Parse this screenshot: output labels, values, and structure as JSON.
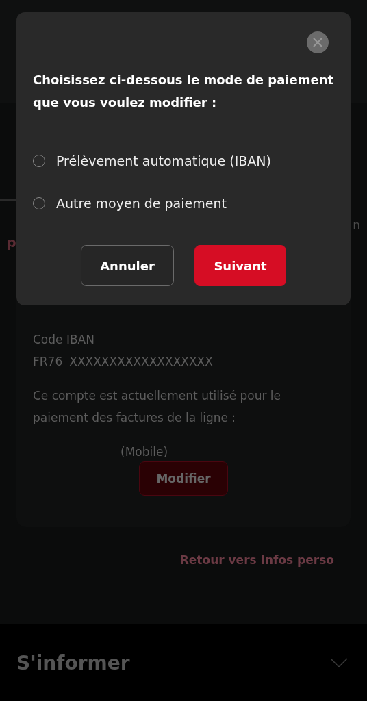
{
  "background": {
    "fragment_left": "p",
    "fragment_right": "n",
    "card": {
      "label": "Code IBAN",
      "iban_prefix": "FR76",
      "iban_masked": "XXXXXXXXXXXXXXXXXX",
      "usage_text": "Ce compte est actuellement utilisé pour le paiement des factures de la ligne :",
      "line": "(Mobile)",
      "button": "Modifier"
    },
    "back_link": "Retour vers Infos perso",
    "footer": {
      "title": "S'informer",
      "expanded": false
    }
  },
  "dialog": {
    "title": "Choisissez ci-dessous le mode de paiement que vous voulez modifier :",
    "options": [
      {
        "label": "Prélèvement automatique (IBAN)",
        "selected": false
      },
      {
        "label": "Autre moyen de paiement",
        "selected": false
      }
    ],
    "buttons": [
      {
        "label": "Annuler",
        "kind": "secondary"
      },
      {
        "label": "Suivant",
        "kind": "primary"
      }
    ]
  }
}
